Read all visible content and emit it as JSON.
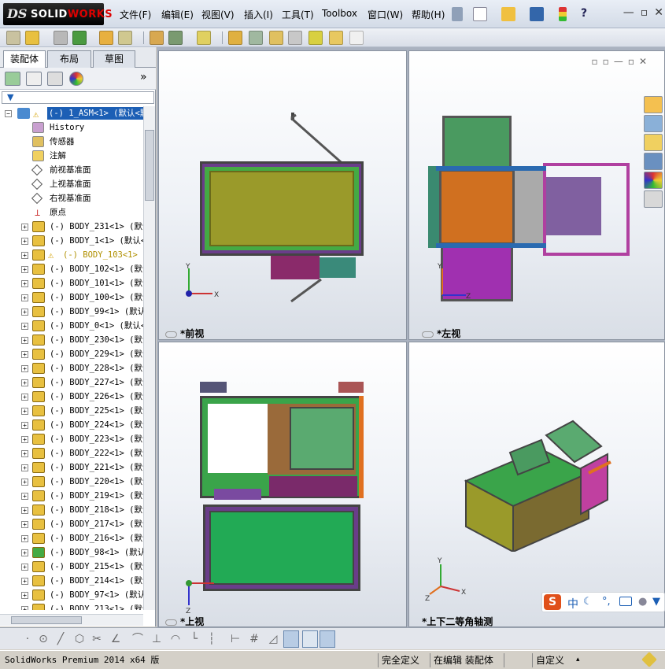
{
  "app": {
    "logo_ds": "DS",
    "logo_text_a": "SOLID",
    "logo_text_b": "WORKS"
  },
  "menu": [
    {
      "label": "文件(F)"
    },
    {
      "label": "编辑(E)"
    },
    {
      "label": "视图(V)"
    },
    {
      "label": "插入(I)"
    },
    {
      "label": "工具(T)"
    },
    {
      "label": "Toolbox"
    },
    {
      "label": "窗口(W)"
    },
    {
      "label": "帮助(H)"
    }
  ],
  "window_controls": {
    "minimize": "—",
    "restore": "▫",
    "close": "✕"
  },
  "panel_tabs": [
    {
      "label": "装配体"
    },
    {
      "label": "布局"
    },
    {
      "label": "草图"
    }
  ],
  "panel_expand": "»",
  "tree": {
    "root": "(-) 1_ASM<1> (默认<默",
    "fixed_items": [
      {
        "label": "History",
        "icon": "history-icon"
      },
      {
        "label": "传感器",
        "icon": "sensor-icon"
      },
      {
        "label": "注解",
        "icon": "annotation-icon"
      },
      {
        "label": "前视基准面",
        "icon": "plane-icon"
      },
      {
        "label": "上视基准面",
        "icon": "plane-icon"
      },
      {
        "label": "右视基准面",
        "icon": "plane-icon"
      },
      {
        "label": "原点",
        "icon": "origin-icon"
      }
    ],
    "components": [
      {
        "label": "(-) BODY_231<1> (默认"
      },
      {
        "label": "(-) BODY_1<1> (默认<"
      },
      {
        "label": "(-) BODY_103<1> (",
        "warning": true
      },
      {
        "label": "(-) BODY_102<1> (默认"
      },
      {
        "label": "(-) BODY_101<1> (默认"
      },
      {
        "label": "(-) BODY_100<1> (默认"
      },
      {
        "label": "(-) BODY_99<1> (默认"
      },
      {
        "label": "(-) BODY_0<1> (默认<"
      },
      {
        "label": "(-) BODY_230<1> (默认"
      },
      {
        "label": "(-) BODY_229<1> (默认"
      },
      {
        "label": "(-) BODY_228<1> (默认"
      },
      {
        "label": "(-) BODY_227<1> (默认"
      },
      {
        "label": "(-) BODY_226<1> (默认"
      },
      {
        "label": "(-) BODY_225<1> (默认"
      },
      {
        "label": "(-) BODY_224<1> (默认"
      },
      {
        "label": "(-) BODY_223<1> (默认"
      },
      {
        "label": "(-) BODY_222<1> (默认"
      },
      {
        "label": "(-) BODY_221<1> (默认"
      },
      {
        "label": "(-) BODY_220<1> (默认"
      },
      {
        "label": "(-) BODY_219<1> (默认"
      },
      {
        "label": "(-) BODY_218<1> (默认"
      },
      {
        "label": "(-) BODY_217<1> (默认"
      },
      {
        "label": "(-) BODY_216<1> (默认"
      },
      {
        "label": "(-) BODY_98<1> (默认",
        "green": true
      },
      {
        "label": "(-) BODY_215<1> (默认"
      },
      {
        "label": "(-) BODY_214<1> (默认"
      },
      {
        "label": "(-) BODY_97<1> (默认"
      },
      {
        "label": "(-) BODY_213<1> (默认"
      }
    ]
  },
  "viewports": {
    "front": {
      "label": "*前视"
    },
    "left": {
      "label": "*左视"
    },
    "top": {
      "label": "*上视"
    },
    "iso": {
      "label": "*上下二等角轴测"
    }
  },
  "axes": {
    "x": "X",
    "y": "Y",
    "z": "Z"
  },
  "ime": {
    "logo": "S",
    "mode": "中"
  },
  "status": {
    "app": "SolidWorks Premium 2014 x64 版",
    "defined": "完全定义",
    "editing": "在编辑 装配体",
    "custom": "自定义",
    "arrow": "▴"
  },
  "colors": {
    "accent": "#1c5fb5",
    "olive": "#9a9a2a",
    "green": "#3aa44a",
    "purple": "#7a2a7a",
    "orange": "#e0701a"
  }
}
